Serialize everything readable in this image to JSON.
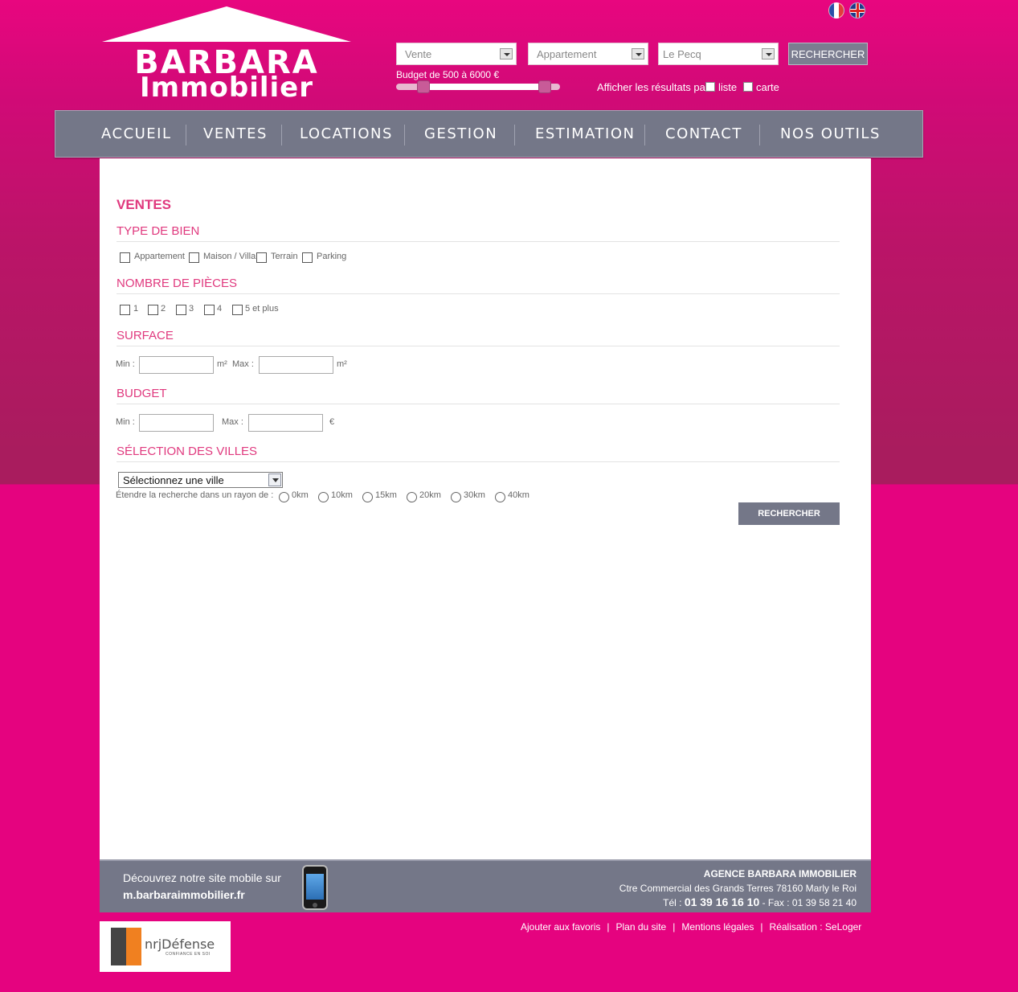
{
  "header": {
    "languages": [
      "fr-flag-icon",
      "uk-flag-icon"
    ],
    "logo": {
      "line1": "BARBARA",
      "line2": "Immobilier"
    },
    "quick_search": {
      "transaction": "Vente",
      "property_type": "Appartement",
      "city": "Le Pecq",
      "button": "RECHERCHER",
      "budget_label": "Budget de 500 à 6000 €",
      "budget_min": 500,
      "budget_max": 6000,
      "display_label": "Afficher les résultats par",
      "display_list": "liste",
      "display_map": "carte"
    }
  },
  "nav": [
    "ACCUEIL",
    "VENTES",
    "LOCATIONS",
    "GESTION",
    "ESTIMATION",
    "CONTACT",
    "NOS OUTILS"
  ],
  "form": {
    "title": "VENTES",
    "type_section": "TYPE DE BIEN",
    "types": [
      "Appartement",
      "Maison / Villa",
      "Terrain",
      "Parking"
    ],
    "rooms_section": "NOMBRE DE PIÈCES",
    "rooms": [
      "1",
      "2",
      "3",
      "4",
      "5 et plus"
    ],
    "surface_section": "SURFACE",
    "min_label": "Min :",
    "max_label": "Max :",
    "m2": "m²",
    "budget_section": "BUDGET",
    "euro": "€",
    "cities_section": "SÉLECTION DES VILLES",
    "city_select": "Sélectionnez une ville",
    "radius_label": "Étendre la recherche dans un rayon de :",
    "radius_options": [
      "0km",
      "10km",
      "15km",
      "20km",
      "30km",
      "40km"
    ],
    "search_button": "RECHERCHER"
  },
  "footer": {
    "mobile_text": "Découvrez notre site mobile sur",
    "mobile_url": "m.barbaraimmobilier.fr",
    "agency": "AGENCE BARBARA IMMOBILIER",
    "address": "Ctre Commercial des Grands Terres 78160 Marly le Roi",
    "tel_label": "Tél :",
    "tel": "01 39 16 16 10",
    "fax": "- Fax : 01 39 58 21 40"
  },
  "bottom_links": [
    "Ajouter aux favoris",
    "Plan du site",
    "Mentions légales",
    "Réalisation : SeLoger"
  ],
  "sponsor": {
    "name": "nrj",
    "name2": "Défense",
    "tagline": "CONFIANCE EN SOI"
  }
}
